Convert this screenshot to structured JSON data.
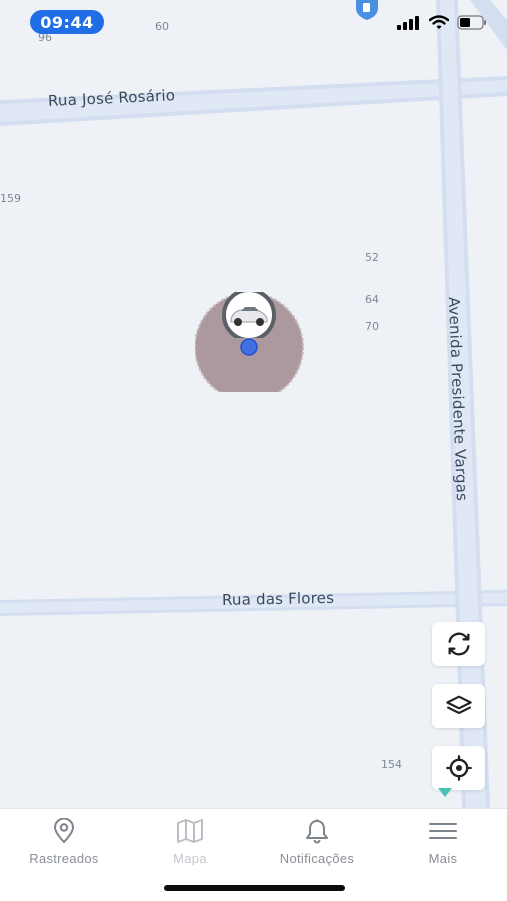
{
  "status_bar": {
    "time": "09:44"
  },
  "map": {
    "roads": {
      "jose_rosario": "Rua José Rosário",
      "flores": "Rua das Flores",
      "presidente_vargas": "Avenida Presidente Vargas"
    },
    "numbers": {
      "n96": "96",
      "n60": "60",
      "n159": "159",
      "n52": "52",
      "n64": "64",
      "n70": "70",
      "n154": "154"
    },
    "accent_color": "#1f6ee6",
    "geofence_color": "#8e7a80"
  },
  "map_controls": {
    "refresh_icon": "refresh-icon",
    "layers_icon": "layers-icon",
    "locate_icon": "locate-icon"
  },
  "bottom_nav": {
    "items": [
      {
        "label": "Rastreados",
        "icon": "map-pin-icon",
        "state": "normal"
      },
      {
        "label": "Mapa",
        "icon": "map-icon",
        "state": "disabled"
      },
      {
        "label": "Notificações",
        "icon": "bell-icon",
        "state": "normal"
      },
      {
        "label": "Mais",
        "icon": "menu-icon",
        "state": "normal"
      }
    ]
  }
}
